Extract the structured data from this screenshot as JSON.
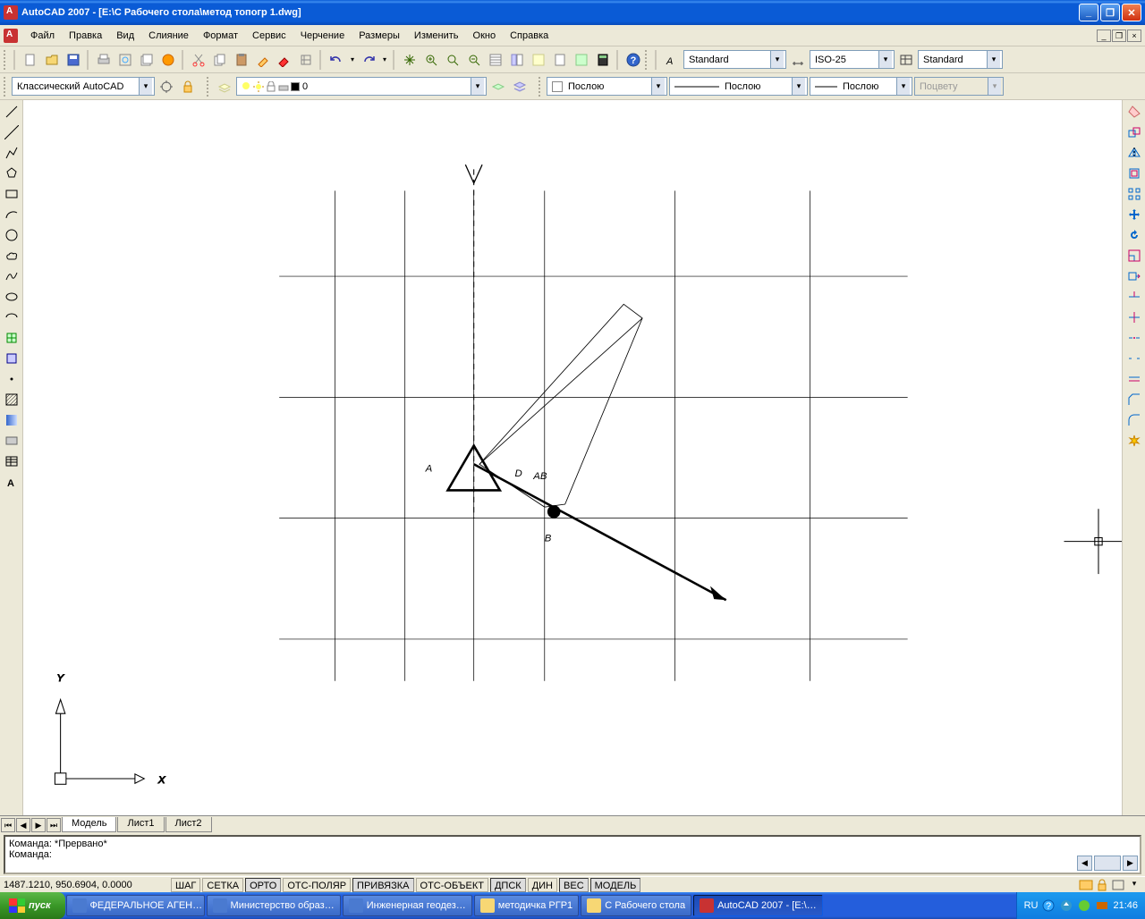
{
  "titlebar": {
    "text": "AutoCAD 2007 - [E:\\С Рабочего стола\\метод топогр 1.dwg]"
  },
  "menu": {
    "items": [
      "Файл",
      "Правка",
      "Вид",
      "Слияние",
      "Формат",
      "Сервис",
      "Черчение",
      "Размеры",
      "Изменить",
      "Окно",
      "Справка"
    ]
  },
  "style_selectors": {
    "text_style": "Standard",
    "dim_style": "ISO-25",
    "table_style": "Standard"
  },
  "workspace": {
    "name": "Классический AutoCAD"
  },
  "layer": {
    "current": "0"
  },
  "props": {
    "color": "Послою",
    "linetype": "Послою",
    "lineweight": "Послою",
    "plotstyle": "Поцвету"
  },
  "tabs": {
    "model": "Модель",
    "sheets": [
      "Лист1",
      "Лист2"
    ]
  },
  "cmd": {
    "line1": "Команда: *Прервано*",
    "line2": "Команда:"
  },
  "status": {
    "coords": "1487.1210, 950.6904, 0.0000",
    "toggles": [
      "ШАГ",
      "СЕТКА",
      "ОРТО",
      "ОТС-ПОЛЯР",
      "ПРИВЯЗКА",
      "ОТС-ОБЪЕКТ",
      "ДПСК",
      "ДИН",
      "ВЕС",
      "МОДЕЛЬ"
    ]
  },
  "drawing": {
    "labels": {
      "A": "A",
      "B": "B",
      "D": "D",
      "AB": "AB"
    }
  },
  "taskbar": {
    "start": "пуск",
    "tasks": [
      "ФЕДЕРАЛЬНОЕ АГЕН…",
      "Министерство образ…",
      "Инженерная геодез…",
      "методичка РГР1",
      "С Рабочего стола",
      "AutoCAD 2007 - [E:\\…"
    ],
    "lang": "RU",
    "time": "21:46"
  }
}
